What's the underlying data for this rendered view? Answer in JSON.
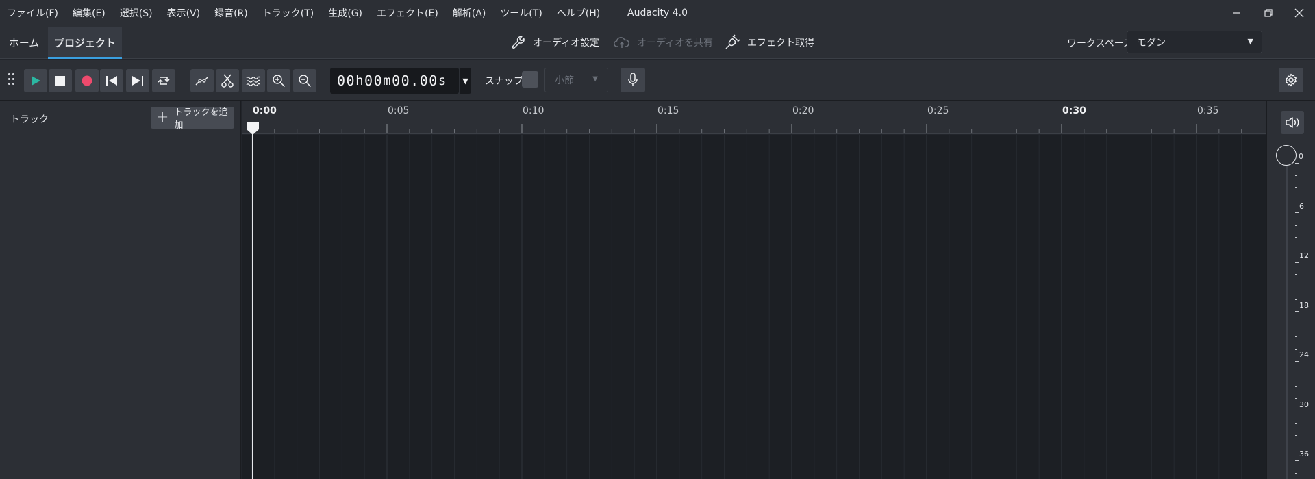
{
  "app": {
    "title": "Audacity 4.0"
  },
  "menu": [
    "ファイル(F)",
    "編集(E)",
    "選択(S)",
    "表示(V)",
    "録音(R)",
    "トラック(T)",
    "生成(G)",
    "エフェクト(E)",
    "解析(A)",
    "ツール(T)",
    "ヘルプ(H)"
  ],
  "tabs": {
    "home": "ホーム",
    "project": "プロジェクト"
  },
  "center_actions": {
    "audio_settings": "オーディオ設定",
    "share_audio": "オーディオを共有",
    "get_effects": "エフェクト取得"
  },
  "workspace": {
    "label": "ワークスペース",
    "value": "モダン"
  },
  "toolbar": {
    "time_h": "00",
    "time_m": "00",
    "time_s": "00.00",
    "snap_label": "スナップ",
    "snap_value": "小節"
  },
  "tracks_panel": {
    "title": "トラック",
    "add_track": "トラックを追加"
  },
  "ruler": {
    "labels": [
      "0:00",
      "0:05",
      "0:10",
      "0:15",
      "0:20",
      "0:25",
      "0:30",
      "0:35"
    ]
  },
  "meter": {
    "labels": [
      "0",
      "6",
      "12",
      "18",
      "24",
      "30",
      "36"
    ]
  },
  "colors": {
    "accent": "#3a9fe0",
    "play": "#2bb7a2",
    "record": "#ee4a6d",
    "background": "#22252b",
    "panel": "#2c2f35"
  }
}
